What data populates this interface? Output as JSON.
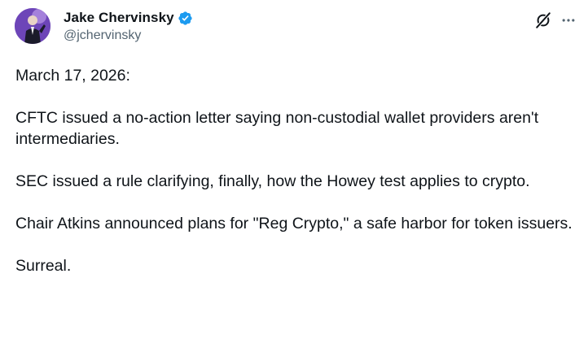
{
  "post": {
    "author": {
      "display_name": "Jake Chervinsky",
      "handle": "@jchervinsky",
      "verified": true,
      "verified_color": "#1d9bf0",
      "avatar_icon": "avatar-photo"
    },
    "actions": {
      "grok_icon": "grok-icon",
      "more_icon": "more-horizontal-icon"
    },
    "paragraphs": [
      "March 17, 2026:",
      "CFTC issued a no-action letter saying non-custodial wallet providers aren't intermediaries.",
      "SEC issued a rule clarifying, finally, how the Howey test applies to crypto.",
      "Chair Atkins announced plans for \"Reg Crypto,\" a safe harbor for token issuers.",
      "Surreal."
    ]
  }
}
